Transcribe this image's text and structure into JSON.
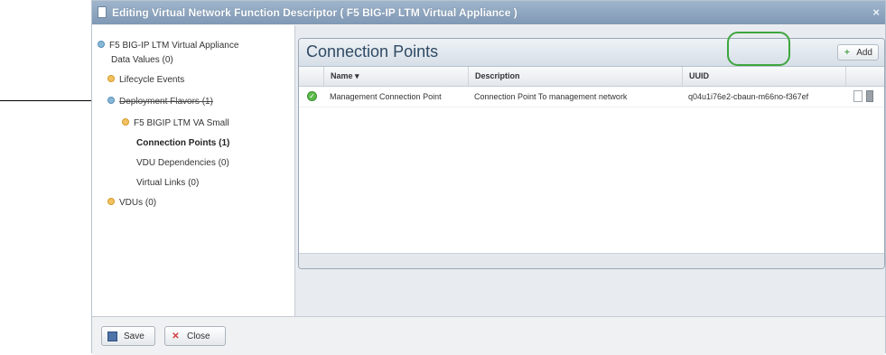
{
  "window": {
    "title": "Editing Virtual Network Function Descriptor ( F5 BIG-IP LTM Virtual Appliance )",
    "close_glyph": "×"
  },
  "tree": {
    "items": [
      {
        "label": "F5 BIG-IP LTM Virtual Appliance",
        "bullet": "blue"
      },
      {
        "label": "Data Values (0)",
        "bullet": "none"
      },
      {
        "label": "Lifecycle Events",
        "bullet": "orange"
      },
      {
        "label": "Deployment Flavors (1)",
        "bullet": "blue"
      },
      {
        "label": "F5 BIGIP LTM VA Small",
        "bullet": "orange"
      },
      {
        "label": "Connection Points (1)",
        "bullet": "none"
      },
      {
        "label": "VDU Dependencies (0)",
        "bullet": "none"
      },
      {
        "label": "Virtual Links (0)",
        "bullet": "none"
      },
      {
        "label": "VDUs (0)",
        "bullet": "orange"
      }
    ]
  },
  "panel": {
    "title": "Connection Points",
    "add_label": "Add",
    "add_glyph": "+",
    "columns": [
      "Name ▾",
      "Description",
      "UUID"
    ],
    "rows": [
      {
        "name": "Management Connection Point",
        "description": "Connection Point To management network",
        "uuid": "q04u1i76e2-cbaun-m66no-f367ef",
        "status_glyph": "✓"
      }
    ]
  },
  "footer": {
    "save_label": "Save",
    "close_label": "Close",
    "close_glyph": "✕"
  },
  "colors": {
    "highlight_ring": "#3ea63e",
    "status_ok": "#5dbb4a",
    "title_bar": "#8ea7c2"
  }
}
